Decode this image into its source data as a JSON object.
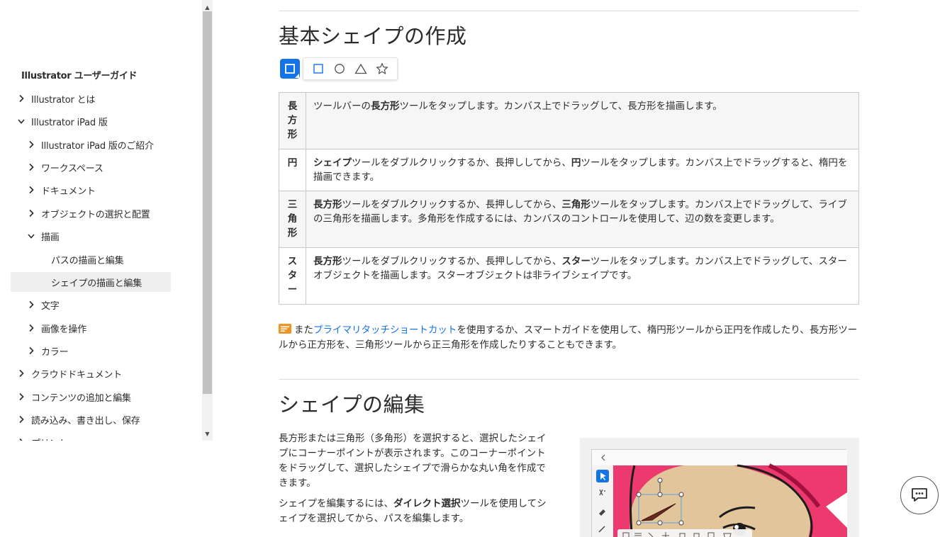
{
  "sidebar": {
    "title": "Illustrator ユーザーガイド",
    "items": [
      {
        "label": "Illustrator とは",
        "expanded": false,
        "has_chevron": true
      },
      {
        "label": "Illustrator iPad 版",
        "expanded": true,
        "has_chevron": true
      },
      {
        "label": "Illustrator iPad 版のご紹介",
        "expanded": false,
        "has_chevron": true
      },
      {
        "label": "ワークスペース",
        "expanded": false,
        "has_chevron": true
      },
      {
        "label": "ドキュメント",
        "expanded": false,
        "has_chevron": true
      },
      {
        "label": "オブジェクトの選択と配置",
        "expanded": false,
        "has_chevron": true
      },
      {
        "label": "描画",
        "expanded": true,
        "has_chevron": true
      },
      {
        "label": "パスの描画と編集",
        "has_chevron": false
      },
      {
        "label": "シェイプの描画と編集",
        "has_chevron": false,
        "selected": true
      },
      {
        "label": "文字",
        "expanded": false,
        "has_chevron": true
      },
      {
        "label": "画像を操作",
        "expanded": false,
        "has_chevron": true
      },
      {
        "label": "カラー",
        "expanded": false,
        "has_chevron": true
      },
      {
        "label": "クラウドドキュメント",
        "expanded": false,
        "has_chevron": true
      },
      {
        "label": "コンテンツの追加と編集",
        "expanded": false,
        "has_chevron": true
      },
      {
        "label": "読み込み、書き出し、保存",
        "expanded": false,
        "has_chevron": true
      },
      {
        "label": "プリント",
        "expanded": false,
        "has_chevron": true
      }
    ]
  },
  "main": {
    "section1_title": "基本シェイプの作成",
    "table": [
      {
        "key": "長方形",
        "parts": [
          {
            "t": "ツールバーの"
          },
          {
            "t": "長方形",
            "b": true
          },
          {
            "t": "ツールをタップします。カンバス上でドラッグして、長方形を描画します。"
          }
        ]
      },
      {
        "key": "円",
        "parts": [
          {
            "t": "シェイプ",
            "b": true
          },
          {
            "t": "ツールをダブルクリックするか、長押ししてから、"
          },
          {
            "t": "円",
            "b": true
          },
          {
            "t": "ツールをタップします。カンバス上でドラッグすると、楕円を描画できます。"
          }
        ]
      },
      {
        "key": "三角形",
        "parts": [
          {
            "t": "長方形",
            "b": true
          },
          {
            "t": "ツールをダブルクリックするか、長押ししてから、"
          },
          {
            "t": "三角形",
            "b": true
          },
          {
            "t": "ツールをタップします。カンバス上でドラッグして、ライブの三角形を描画します。多角形を作成するには、カンバスのコントロールを使用して、辺の数を変更します。"
          }
        ]
      },
      {
        "key": "スター",
        "parts": [
          {
            "t": "長方形",
            "b": true
          },
          {
            "t": "ツールをダブルクリックするか、長押ししてから、"
          },
          {
            "t": "スター",
            "b": true
          },
          {
            "t": "ツールをタップします。カンバス上でドラッグして、スターオブジェクトを描画します。スターオブジェクトは非ライブシェイプです。"
          }
        ]
      }
    ],
    "note_prefix": "また",
    "note_link": "プライマリタッチショートカット",
    "note_suffix": "を使用するか、スマートガイドを使用して、楕円形ツールから正円を作成したり、長方形ツールから正方形を、三角形ツールから正三角形を作成したりすることもできます。",
    "section2_title": "シェイプの編集",
    "para1": "長方形または三角形（多角形）を選択すると、選択したシェイプにコーナーポイントが表示されます。このコーナーポイントをドラッグして、選択したシェイプで滑らかな丸い角を作成できます。",
    "para2_prefix": "シェイプを編集するには、",
    "para2_bold": "ダイレクト選択",
    "para2_suffix": "ツールを使用してシェイプを選択してから、パスを編集します。"
  },
  "colors": {
    "accent": "#1473e6",
    "note_icon": "#f29423",
    "figure_pink": "#ec3a6e",
    "figure_skin": "#e2c59a"
  },
  "icons": {
    "chevron_right": "chevron-right-icon",
    "chevron_down": "chevron-down-icon",
    "rectangle_tool": "rectangle-tool-icon",
    "ellipse_tool": "ellipse-tool-icon",
    "triangle_tool": "triangle-tool-icon",
    "star_tool": "star-tool-icon",
    "note": "note-icon",
    "chat": "chat-icon"
  }
}
